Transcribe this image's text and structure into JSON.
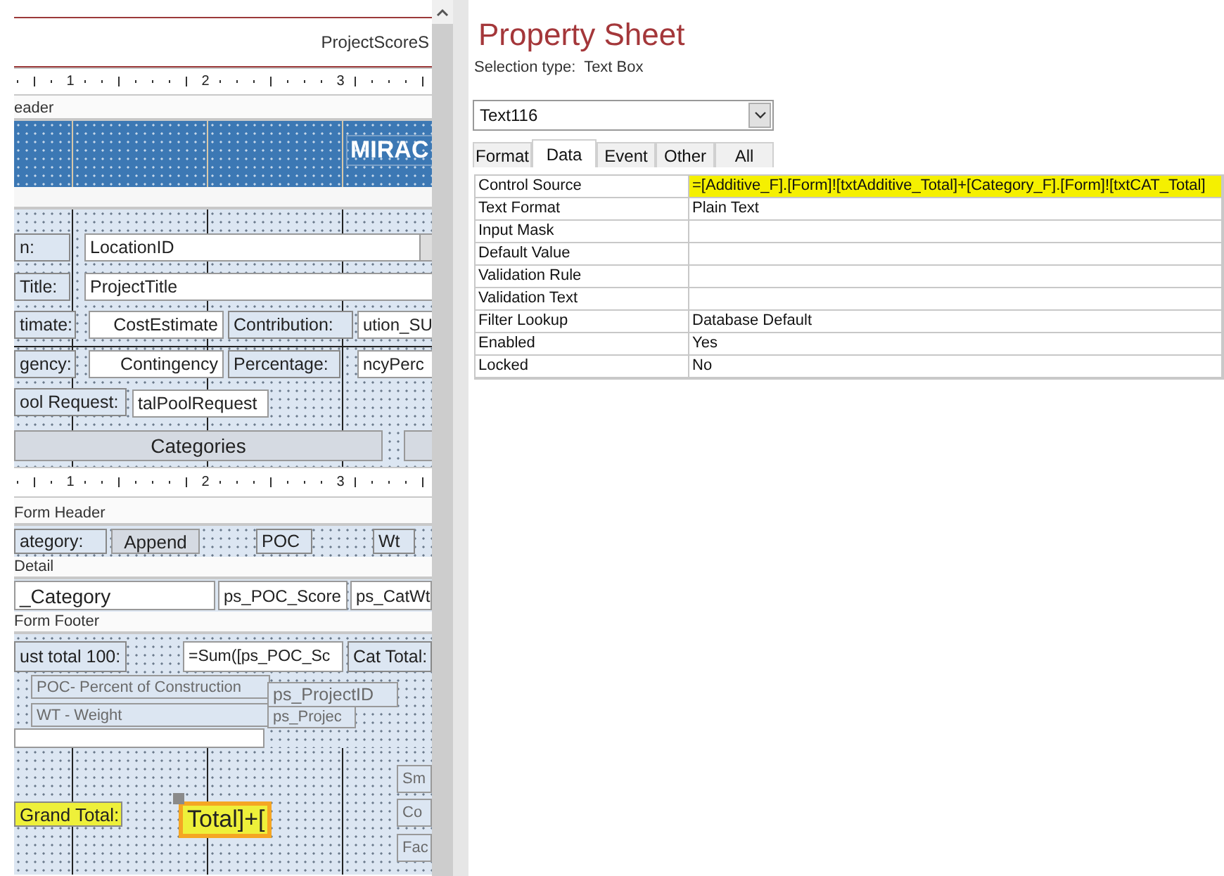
{
  "report_header": {
    "text": "ProjectScoreS"
  },
  "rulers": [
    {
      "ticks": [
        "1",
        "2",
        "3"
      ]
    },
    {
      "ticks": [
        "1",
        "2",
        "3"
      ]
    }
  ],
  "main_form": {
    "section_label": "eader",
    "banner_title": "MIRAC",
    "controls": [
      {
        "kind": "label",
        "text": "n:"
      },
      {
        "kind": "combo",
        "text": "LocationID"
      },
      {
        "kind": "label",
        "text": "Title:"
      },
      {
        "kind": "textbox",
        "text": "ProjectTitle"
      },
      {
        "kind": "label",
        "text": "timate:"
      },
      {
        "kind": "textbox",
        "text": "CostEstimate"
      },
      {
        "kind": "label",
        "text": "Contribution:"
      },
      {
        "kind": "textbox",
        "text": "ution_SU"
      },
      {
        "kind": "label",
        "text": "gency:"
      },
      {
        "kind": "textbox",
        "text": "Contingency"
      },
      {
        "kind": "label",
        "text": "Percentage:"
      },
      {
        "kind": "textbox",
        "text": "ncyPerc"
      },
      {
        "kind": "label",
        "text": "ool Request:"
      },
      {
        "kind": "textbox",
        "text": "talPoolRequest"
      },
      {
        "kind": "button",
        "text": "Categories"
      },
      {
        "kind": "button"
      }
    ]
  },
  "subform": {
    "sections": [
      {
        "title": "Form Header",
        "controls": [
          {
            "kind": "label",
            "text": "ategory:"
          },
          {
            "kind": "button",
            "text": "Append"
          },
          {
            "kind": "label",
            "text": "POC"
          },
          {
            "kind": "label",
            "text": "Wt"
          }
        ]
      },
      {
        "title": "Detail",
        "controls": [
          {
            "kind": "textbox",
            "text": "_Category"
          },
          {
            "kind": "textbox",
            "text": "ps_POC_Score"
          },
          {
            "kind": "textbox",
            "text": "ps_CatWt"
          }
        ]
      },
      {
        "title": "Form Footer",
        "controls": [
          {
            "kind": "label",
            "text": "ust total 100:"
          },
          {
            "kind": "textbox",
            "text": "=Sum([ps_POC_Sc"
          },
          {
            "kind": "label",
            "text": "Cat Total:"
          },
          {
            "kind": "note",
            "text": "POC- Percent of Construction"
          },
          {
            "kind": "note",
            "text": "WT - Weight"
          },
          {
            "kind": "note",
            "text": "ps_ProjectID"
          },
          {
            "kind": "note",
            "text": "ps_Projec"
          }
        ]
      }
    ]
  },
  "totals_area": {
    "controls": [
      {
        "kind": "label",
        "text": "Grand Total:",
        "selected": false,
        "highlighted": true
      },
      {
        "kind": "textbox",
        "text": "Total]+[",
        "selected": true,
        "highlighted": true
      },
      {
        "kind": "note",
        "text": "Sm",
        "selected": false,
        "highlighted": false
      },
      {
        "kind": "note",
        "text": "Co",
        "selected": false,
        "highlighted": false
      },
      {
        "kind": "note",
        "text": "Fac",
        "selected": false,
        "highlighted": false
      }
    ]
  },
  "property_sheet": {
    "title": "Property Sheet",
    "selection_type": "Selection type:  Text Box",
    "object": "Text116",
    "tabs": [
      {
        "label": "Format",
        "selected": false
      },
      {
        "label": "Data",
        "selected": true
      },
      {
        "label": "Event",
        "selected": false
      },
      {
        "label": "Other",
        "selected": false
      },
      {
        "label": "All",
        "selected": false
      }
    ],
    "properties": [
      {
        "name": "Control Source",
        "value": "=[Additive_F].[Form]![txtAdditive_Total]+[Category_F].[Form]![txtCAT_Total]",
        "highlighted": true
      },
      {
        "name": "Text Format",
        "value": "Plain Text",
        "highlighted": false
      },
      {
        "name": "Input Mask",
        "highlighted": false
      },
      {
        "name": "Default Value",
        "highlighted": false
      },
      {
        "name": "Validation Rule",
        "highlighted": false
      },
      {
        "name": "Validation Text",
        "highlighted": false
      },
      {
        "name": "Filter Lookup",
        "value": "Database Default",
        "highlighted": false
      },
      {
        "name": "Enabled",
        "value": "Yes",
        "highlighted": false
      },
      {
        "name": "Locked",
        "value": "No",
        "highlighted": false
      }
    ]
  }
}
